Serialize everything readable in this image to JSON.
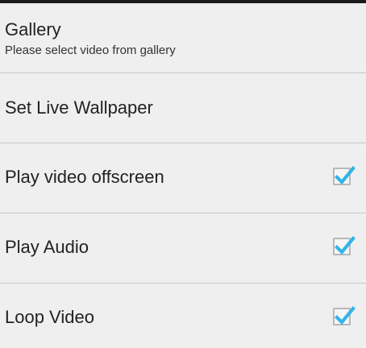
{
  "settings": {
    "items": [
      {
        "title": "Gallery",
        "summary": "Please select video from gallery"
      },
      {
        "title": "Set Live Wallpaper"
      },
      {
        "title": "Play video offscreen",
        "checked": true
      },
      {
        "title": "Play Audio",
        "checked": true
      },
      {
        "title": "Loop Video",
        "checked": true
      }
    ],
    "check_color": "#33b5e5"
  }
}
